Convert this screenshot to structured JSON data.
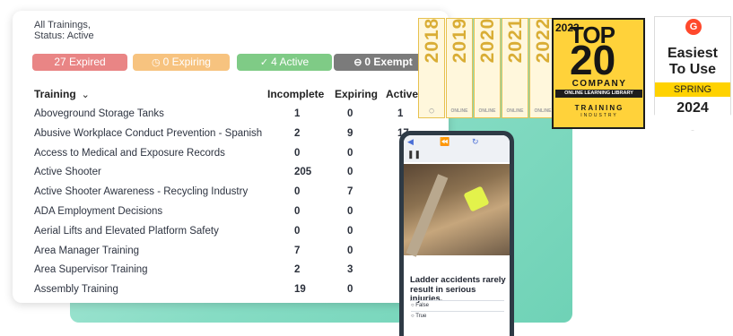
{
  "filters": {
    "line1": "All Trainings,",
    "line2": "Status: Active"
  },
  "summary_chips": {
    "expired": "27 Expired",
    "expiring": "0 Expiring",
    "active": "4 Active",
    "exempt": "0 Exempt"
  },
  "table": {
    "columns": {
      "training": "Training",
      "incomplete": "Incomplete",
      "expiring": "Expiring",
      "active": "Active"
    },
    "rows": [
      {
        "name": "Aboveground Storage Tanks",
        "incomplete": "1",
        "expiring": "0",
        "active": "1"
      },
      {
        "name": "Abusive Workplace Conduct Prevention - Spanish",
        "incomplete": "2",
        "expiring": "9",
        "active": "17"
      },
      {
        "name": "Access to Medical and Exposure Records",
        "incomplete": "0",
        "expiring": "0",
        "active": ""
      },
      {
        "name": "Active Shooter",
        "incomplete": "205",
        "expiring": "0",
        "active": ""
      },
      {
        "name": "Active Shooter Awareness - Recycling Industry",
        "incomplete": "0",
        "expiring": "7",
        "active": ""
      },
      {
        "name": "ADA Employment Decisions",
        "incomplete": "0",
        "expiring": "0",
        "active": ""
      },
      {
        "name": "Aerial Lifts and Elevated Platform Safety",
        "incomplete": "0",
        "expiring": "0",
        "active": ""
      },
      {
        "name": "Area Manager Training",
        "incomplete": "7",
        "expiring": "0",
        "active": ""
      },
      {
        "name": "Area Supervisor Training",
        "incomplete": "2",
        "expiring": "3",
        "active": ""
      },
      {
        "name": "Assembly Training",
        "incomplete": "19",
        "expiring": "0",
        "active": ""
      }
    ]
  },
  "phone": {
    "quiz_question": "Ladder accidents rarely result in serious injuries.",
    "options": [
      "False",
      "True"
    ]
  },
  "badges": {
    "years": [
      "2018",
      "2019",
      "2020",
      "2021",
      "2022"
    ],
    "year_footer": "ONLINE",
    "top20": {
      "year": "2023",
      "top": "TOP",
      "number": "20",
      "company": "COMPANY",
      "category": "ONLINE LEARNING LIBRARY",
      "brand": "TRAINING",
      "brand_sub": "INDUSTRY"
    },
    "g2": {
      "logo": "G",
      "line1": "Easiest",
      "line2": "To Use",
      "season": "SPRING",
      "year": "2024"
    }
  },
  "colors": {
    "expired": "#e98585",
    "expiring": "#f7c37f",
    "active": "#7fcb86",
    "exempt": "#7b7b7b",
    "teal": "#86dcc4",
    "gold": "#ffd23a"
  }
}
